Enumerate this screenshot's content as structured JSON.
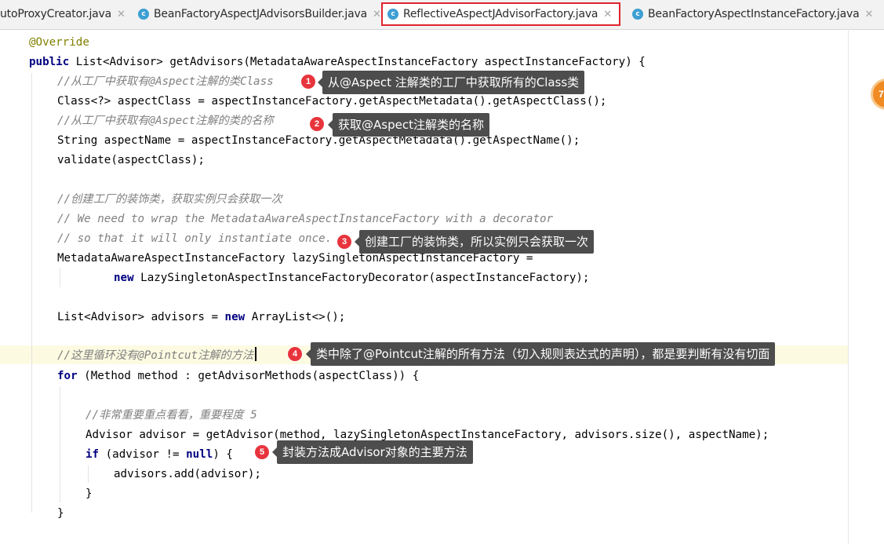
{
  "tabs": [
    {
      "label": "utoProxyCreator.java",
      "active": false,
      "has_icon": false
    },
    {
      "label": "BeanFactoryAspectJAdvisorsBuilder.java",
      "active": false,
      "has_icon": true
    },
    {
      "label": "ReflectiveAspectJAdvisorFactory.java",
      "active": true,
      "has_icon": true
    },
    {
      "label": "BeanFactoryAspectInstanceFactory.java",
      "active": false,
      "has_icon": true
    }
  ],
  "tab_icon_letter": "c",
  "tab_close_glyph": "✕",
  "side_bubble_text": "7",
  "code": {
    "l1": [
      "@Override"
    ],
    "l2": [
      "public",
      " List<Advisor> getAdvisors(MetadataAwareAspectInstanceFactory aspectInstanceFactory) {"
    ],
    "l3": [
      "//从工厂中获取有@Aspect注解的类Class"
    ],
    "l4": [
      "Class<?> aspectClass = aspectInstanceFactory.getAspectMetadata().getAspectClass();"
    ],
    "l5": [
      "//从工厂中获取有@Aspect注解的类的名称"
    ],
    "l6": [
      "String aspectName = aspectInstanceFactory.getAspectMetadata().getAspectName();"
    ],
    "l7": [
      "validate(aspectClass);"
    ],
    "l8": [
      "//创建工厂的装饰类，获取实例只会获取一次"
    ],
    "l9": [
      "// We need to wrap the MetadataAwareAspectInstanceFactory with a decorator"
    ],
    "l10": [
      "// so that it will only instantiate once."
    ],
    "l11": [
      "MetadataAwareAspectInstanceFactory lazySingletonAspectInstanceFactory ="
    ],
    "l12": [
      "new",
      " LazySingletonAspectInstanceFactoryDecorator(aspectInstanceFactory);"
    ],
    "l13": [
      "List<Advisor> advisors = ",
      "new",
      " ArrayList<>();"
    ],
    "l14": [
      "//这里循环没有@Pointcut注解的方法"
    ],
    "l15": [
      "for",
      " (Method method : getAdvisorMethods(aspectClass)) {"
    ],
    "l16": [
      "//非常重要重点看看，重要程度 5"
    ],
    "l17": [
      "Advisor advisor = getAdvisor(method, lazySingletonAspectInstanceFactory, advisors.size(), aspectName);"
    ],
    "l18": [
      "if",
      " (advisor != ",
      "null",
      ") {"
    ],
    "l19": [
      "advisors.add(advisor);"
    ],
    "l20": [
      "}"
    ],
    "l21": [
      "}"
    ]
  },
  "callouts": [
    {
      "num": "1",
      "text": "从@Aspect 注解类的工厂中获取所有的Class类"
    },
    {
      "num": "2",
      "text": "获取@Aspect注解类的名称"
    },
    {
      "num": "3",
      "text": "创建工厂的装饰类，所以实例只会获取一次"
    },
    {
      "num": "4",
      "text": "类中除了@Pointcut注解的所有方法（切入规则表达式的声明），都是要判断有没有切面"
    },
    {
      "num": "5",
      "text": "封装方法成Advisor对象的主要方法"
    }
  ]
}
